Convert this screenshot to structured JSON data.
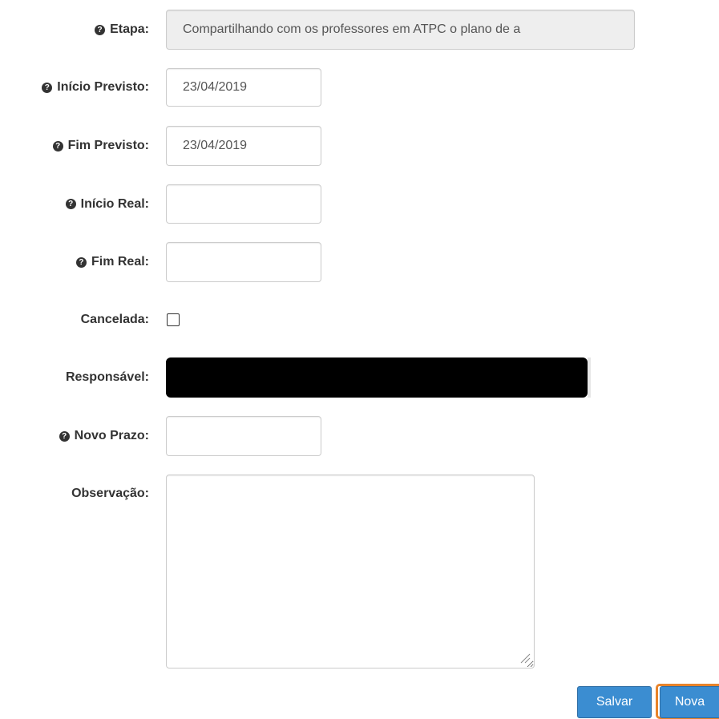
{
  "form": {
    "etapa": {
      "label": "Etapa:",
      "value": "Compartilhando com os professores em ATPC o plano de a"
    },
    "inicio_previsto": {
      "label": "Início Previsto:",
      "value": "23/04/2019"
    },
    "fim_previsto": {
      "label": "Fim Previsto:",
      "value": "23/04/2019"
    },
    "inicio_real": {
      "label": "Início Real:",
      "value": ""
    },
    "fim_real": {
      "label": "Fim Real:",
      "value": ""
    },
    "cancelada": {
      "label": "Cancelada:",
      "checked": false
    },
    "responsavel": {
      "label": "Responsável:"
    },
    "novo_prazo": {
      "label": "Novo Prazo:",
      "value": ""
    },
    "observacao": {
      "label": "Observação:",
      "value": ""
    }
  },
  "actions": {
    "save_label": "Salvar",
    "new_label": "Nova"
  },
  "icons": {
    "help": "question-circle-icon"
  },
  "colors": {
    "primary_button": "#3b8dd1",
    "focus_ring": "#e8832a",
    "readonly_bg": "#eeeeee"
  }
}
